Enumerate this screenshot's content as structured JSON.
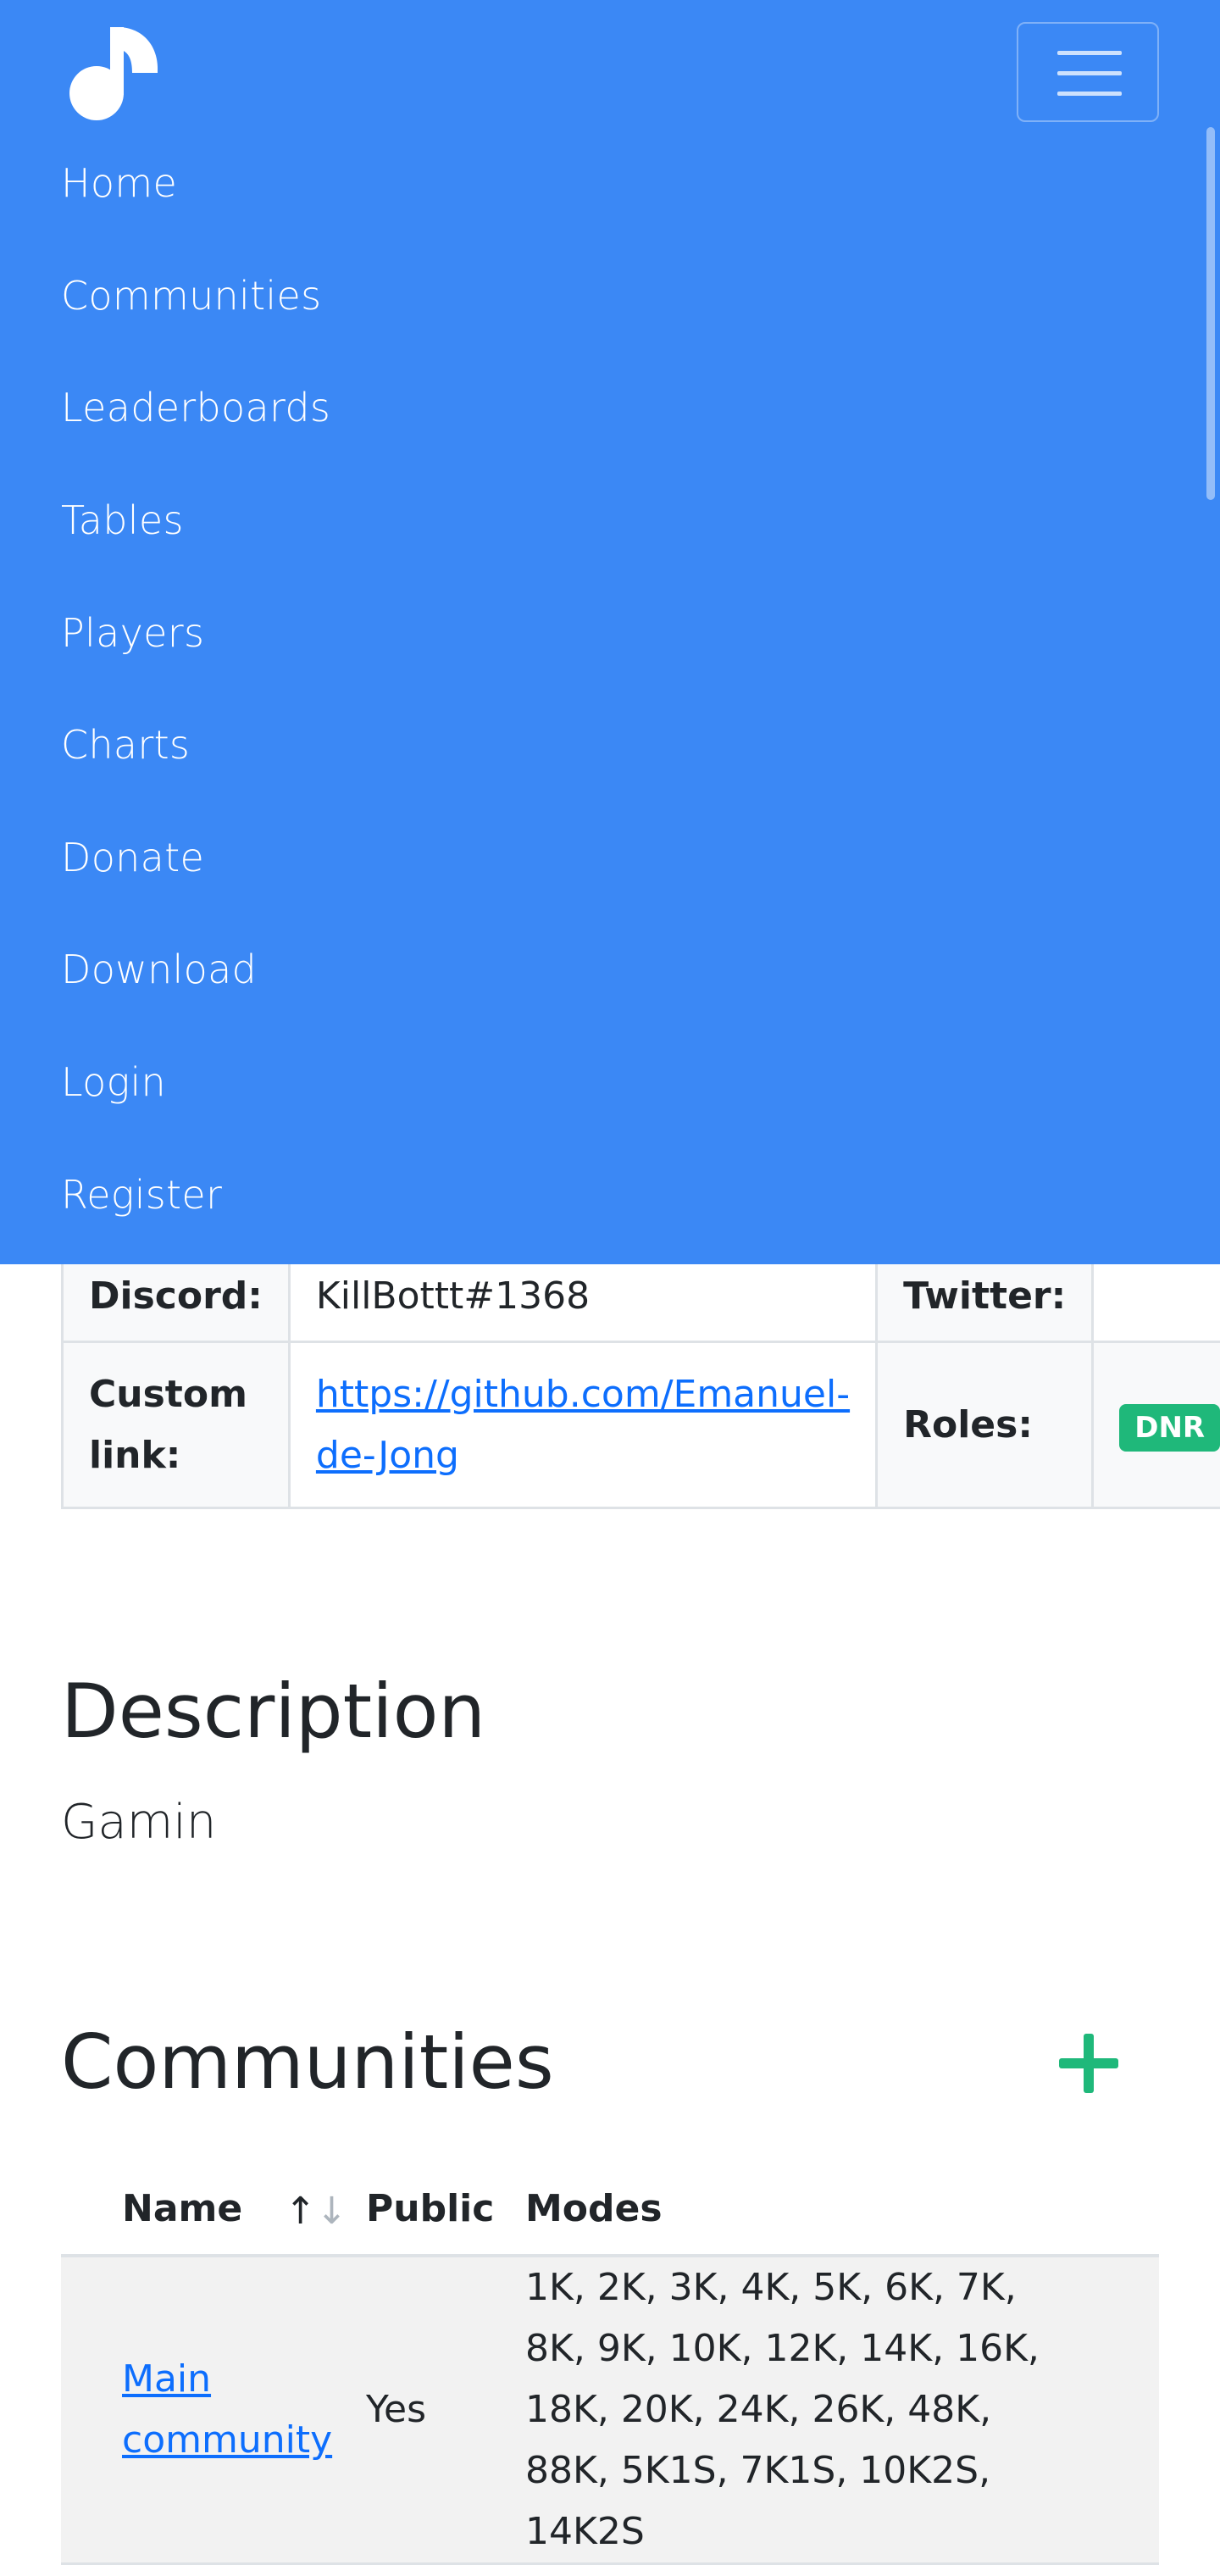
{
  "nav": {
    "items": [
      {
        "label": "Home"
      },
      {
        "label": "Communities"
      },
      {
        "label": "Leaderboards"
      },
      {
        "label": "Tables"
      },
      {
        "label": "Players"
      },
      {
        "label": "Charts"
      },
      {
        "label": "Donate"
      },
      {
        "label": "Download"
      },
      {
        "label": "Login"
      },
      {
        "label": "Register"
      }
    ],
    "color": "#3b88f5"
  },
  "profile": {
    "discord_label": "Discord:",
    "discord_value": "KillBottt#1368",
    "twitter_label": "Twitter:",
    "twitter_value": "",
    "custom_link_label": "Custom link:",
    "custom_link_value": "https://github.com/Emanuel-de-Jong",
    "roles_label": "Roles:",
    "roles": [
      "DNR"
    ]
  },
  "description": {
    "title": "Description",
    "text": "Gamin"
  },
  "communities": {
    "title": "Communities",
    "columns": {
      "name": "Name",
      "sort": "↑↓",
      "public": "Public",
      "modes": "Modes"
    },
    "rows": [
      {
        "name": "Main community",
        "public": "Yes",
        "modes": "1K, 2K, 3K, 4K, 5K, 6K, 7K, 8K, 9K, 10K, 12K, 14K, 16K, 18K, 20K, 24K, 26K, 48K, 88K, 5K1S, 7K1S, 10K2S, 14K2S"
      }
    ]
  },
  "colors": {
    "accent_green": "#1fb87a",
    "link": "#0d6efd"
  }
}
